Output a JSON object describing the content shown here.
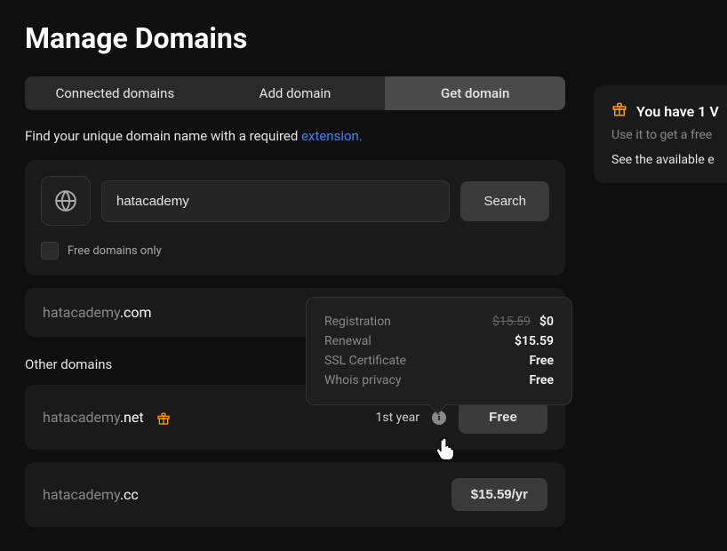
{
  "page_title": "Manage Domains",
  "tabs": {
    "connected": "Connected domains",
    "add": "Add domain",
    "get": "Get domain"
  },
  "intro_text": "Find your unique domain name with a required ",
  "intro_link": "extension.",
  "search": {
    "value": "hatacademy",
    "button": "Search",
    "free_only_label": "Free domains only"
  },
  "primary_domain": {
    "sld": "hatacademy",
    "tld": ".com"
  },
  "other_section_title": "Other domains",
  "other_domains": [
    {
      "sld": "hatacademy",
      "tld": ".net",
      "year_label": "1st year",
      "price_label": "Free",
      "has_gift": true
    },
    {
      "sld": "hatacademy",
      "tld": ".cc",
      "price_label": "$15.59/yr"
    }
  ],
  "tooltip": {
    "rows": [
      {
        "label": "Registration",
        "strike": "$15.59",
        "value": "$0"
      },
      {
        "label": "Renewal",
        "value": "$15.59"
      },
      {
        "label": "SSL Certificate",
        "value": "Free"
      },
      {
        "label": "Whois privacy",
        "value": "Free"
      }
    ]
  },
  "side": {
    "title": "You have 1  V",
    "sub": "Use it to get a free",
    "link": "See the available e"
  },
  "colors": {
    "accent": "#f59e0b",
    "link": "#3b82f6"
  }
}
